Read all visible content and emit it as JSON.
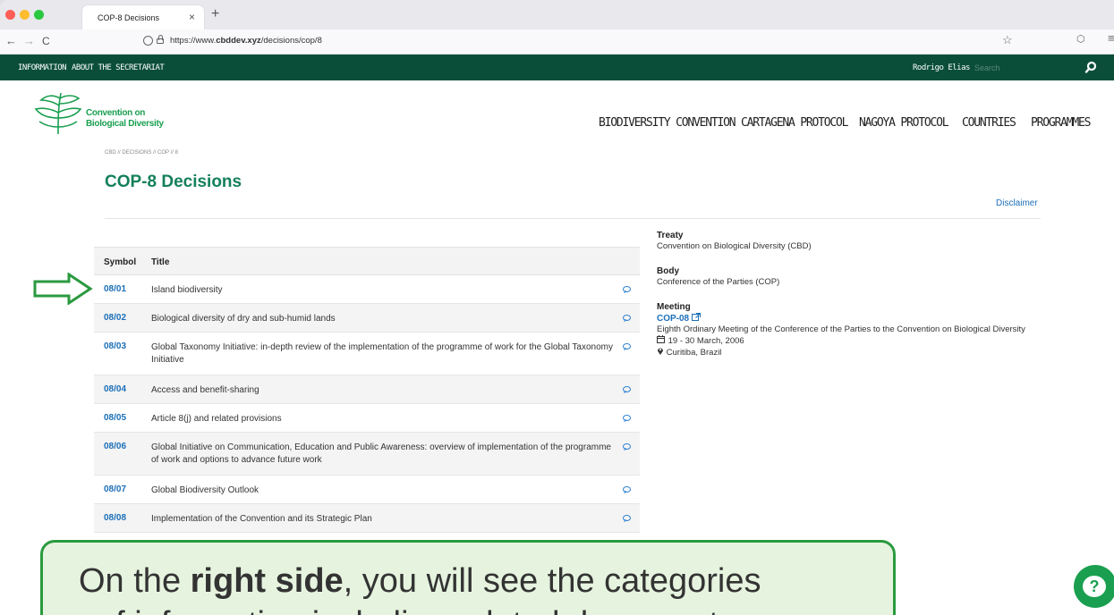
{
  "browser": {
    "tab_title": "COP-8 Decisions",
    "tab_close": "×",
    "new_tab": "+",
    "back": "←",
    "forward": "→",
    "reload": "C",
    "url_prefix": "https://www.",
    "url_domain": "cbddev.xyz",
    "url_path": "/decisions/cop/8",
    "bookmark_glyph": "☆",
    "pocket_glyph": "⬡",
    "menu_glyph": "≡"
  },
  "site_bar": {
    "items": [
      "INFORMATION",
      "ABOUT THE SECRETARIAT"
    ],
    "user": "Rodrigo Elias",
    "search_placeholder": "Search"
  },
  "logo": {
    "line1": "Convention on",
    "line2": "Biological Diversity"
  },
  "main_nav": [
    "BIODIVERSITY CONVENTION",
    "CARTAGENA PROTOCOL",
    "NAGOYA PROTOCOL",
    "COUNTRIES",
    "PROGRAMMES"
  ],
  "breadcrumb": "CBD // DECISIONS // COP // 8",
  "page_title": "COP-8 Decisions",
  "disclaimer": "Disclaimer",
  "table": {
    "headers": [
      "Symbol",
      "Title"
    ],
    "rows": [
      {
        "symbol": "08/01",
        "title": "Island biodiversity"
      },
      {
        "symbol": "08/02",
        "title": "Biological diversity of dry and sub-humid lands"
      },
      {
        "symbol": "08/03",
        "title": "Global Taxonomy Initiative:  in-depth review of the implementation of the programme of work for the Global Taxonomy Initiative"
      },
      {
        "symbol": "08/04",
        "title": "Access and benefit-sharing"
      },
      {
        "symbol": "08/05",
        "title": "Article 8(j) and related provisions"
      },
      {
        "symbol": "08/06",
        "title": "Global Initiative on Communication, Education and Public Awareness:  overview of implementation of the programme of work and options to advance future work"
      },
      {
        "symbol": "08/07",
        "title": "Global Biodiversity Outlook"
      },
      {
        "symbol": "08/08",
        "title": "Implementation of the Convention and its Strategic Plan"
      }
    ]
  },
  "panel": {
    "treaty_label": "Treaty",
    "treaty_value": "Convention on Biological Diversity (CBD)",
    "body_label": "Body",
    "body_value": "Conference of the Parties (COP)",
    "meeting_label": "Meeting",
    "meeting_code": "COP-08",
    "meeting_name": "Eighth Ordinary Meeting of the Conference of the Parties to the Convention on Biological Diversity",
    "meeting_dates": "19 - 30 March, 2006",
    "meeting_location": "Curitiba, Brazil"
  },
  "callout": {
    "line1_pre": "On the ",
    "line1_bold": "right side",
    "line1_post": ", you will see the categories",
    "line2": "of information including related documents"
  },
  "help_glyph": "?",
  "colors": {
    "site_green": "#0a4e3a",
    "brand_green": "#1a9f50",
    "title_green": "#14805a",
    "link_blue": "#1b6fb8",
    "callout_border": "#2a9a3f",
    "callout_bg": "#e6f4df"
  }
}
